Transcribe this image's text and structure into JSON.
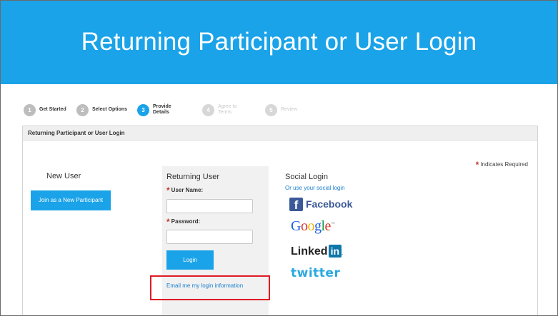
{
  "banner": {
    "title": "Returning Participant or User Login"
  },
  "steps": [
    {
      "num": "1",
      "label": "Get Started"
    },
    {
      "num": "2",
      "label": "Select Options"
    },
    {
      "num": "3",
      "label": "Provide Details"
    },
    {
      "num": "4",
      "label": "Agree to Terms"
    },
    {
      "num": "5",
      "label": "Review"
    }
  ],
  "panel": {
    "header": "Returning Participant or User Login",
    "required_star": "*",
    "required_note": "Indicates Required"
  },
  "new_user": {
    "title": "New User",
    "join_button": "Join as a New Participant"
  },
  "returning_user": {
    "title": "Returning User",
    "username_label": "User Name:",
    "username_value": "",
    "password_label": "Password:",
    "password_value": "",
    "login_button": "Login",
    "email_link": "Email me my login information"
  },
  "social": {
    "title": "Social Login",
    "subtitle": "Or use your social login",
    "facebook": {
      "icon": "f",
      "label": "Facebook"
    },
    "google": {
      "letters": [
        "G",
        "o",
        "o",
        "g",
        "l",
        "e"
      ],
      "mark": "™"
    },
    "linkedin": {
      "text": "Linked",
      "box": "in",
      "mark": "."
    },
    "twitter": "twitter"
  },
  "colors": {
    "banner": "#1aa3e8",
    "accent": "#1aa3e8",
    "required": "#c0392b",
    "highlight": "#e01b24",
    "facebook": "#3b5998",
    "linkedin": "#0e76a8",
    "twitter": "#2aa9e0"
  }
}
